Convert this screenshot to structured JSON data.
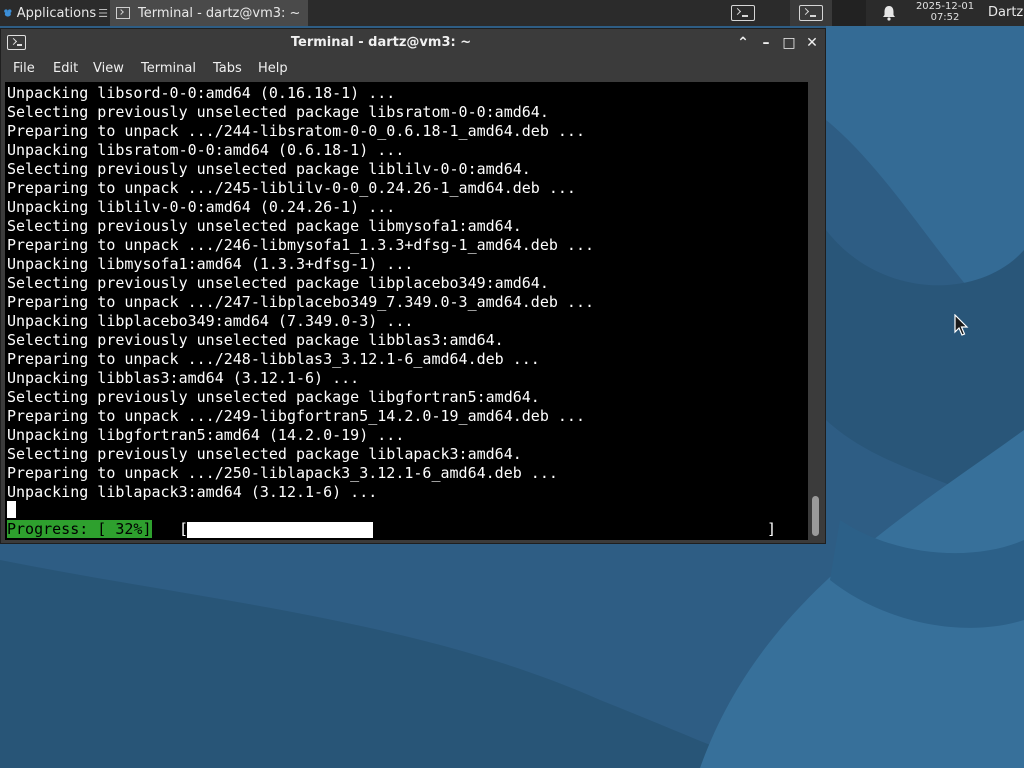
{
  "panel": {
    "applications_label": "Applications",
    "applications_more": "☰",
    "task_title": "Terminal - dartz@vm3: ~",
    "clock_date": "2025-12-01",
    "clock_time": "07:52",
    "user": "Dartz"
  },
  "window": {
    "title": "Terminal - dartz@vm3: ~",
    "controls": {
      "up": "⌃",
      "minimize": "–",
      "maximize": "□",
      "close": "✕"
    },
    "menu": [
      "File",
      "Edit",
      "View",
      "Terminal",
      "Tabs",
      "Help"
    ]
  },
  "terminal": {
    "lines": [
      "Unpacking libsord-0-0:amd64 (0.16.18-1) ...",
      "Selecting previously unselected package libsratom-0-0:amd64.",
      "Preparing to unpack .../244-libsratom-0-0_0.6.18-1_amd64.deb ...",
      "Unpacking libsratom-0-0:amd64 (0.6.18-1) ...",
      "Selecting previously unselected package liblilv-0-0:amd64.",
      "Preparing to unpack .../245-liblilv-0-0_0.24.26-1_amd64.deb ...",
      "Unpacking liblilv-0-0:amd64 (0.24.26-1) ...",
      "Selecting previously unselected package libmysofa1:amd64.",
      "Preparing to unpack .../246-libmysofa1_1.3.3+dfsg-1_amd64.deb ...",
      "Unpacking libmysofa1:amd64 (1.3.3+dfsg-1) ...",
      "Selecting previously unselected package libplacebo349:amd64.",
      "Preparing to unpack .../247-libplacebo349_7.349.0-3_amd64.deb ...",
      "Unpacking libplacebo349:amd64 (7.349.0-3) ...",
      "Selecting previously unselected package libblas3:amd64.",
      "Preparing to unpack .../248-libblas3_3.12.1-6_amd64.deb ...",
      "Unpacking libblas3:amd64 (3.12.1-6) ...",
      "Selecting previously unselected package libgfortran5:amd64.",
      "Preparing to unpack .../249-libgfortran5_14.2.0-19_amd64.deb ...",
      "Unpacking libgfortran5:amd64 (14.2.0-19) ...",
      "Selecting previously unselected package liblapack3:amd64.",
      "Preparing to unpack .../250-liblapack3_3.12.1-6_amd64.deb ...",
      "Unpacking liblapack3:amd64 (3.12.1-6) ..."
    ],
    "progress_label": "Progress: [ 32%]",
    "progress_open": "[",
    "progress_close": "]",
    "progress_fraction": 0.32
  },
  "colors": {
    "terminal_bg": "#000000",
    "terminal_fg": "#ffffff",
    "progress_label_bg": "#2ea02e",
    "window_chrome": "#3b3b3b",
    "panel_bg": "#2b2b2b",
    "wallpaper": "#2f5f86"
  },
  "icons": {
    "applications": "xfce-mouse-logo-icon",
    "terminal": "terminal-icon",
    "notifications": "bell-icon",
    "pointer": "mouse-pointer-icon"
  }
}
